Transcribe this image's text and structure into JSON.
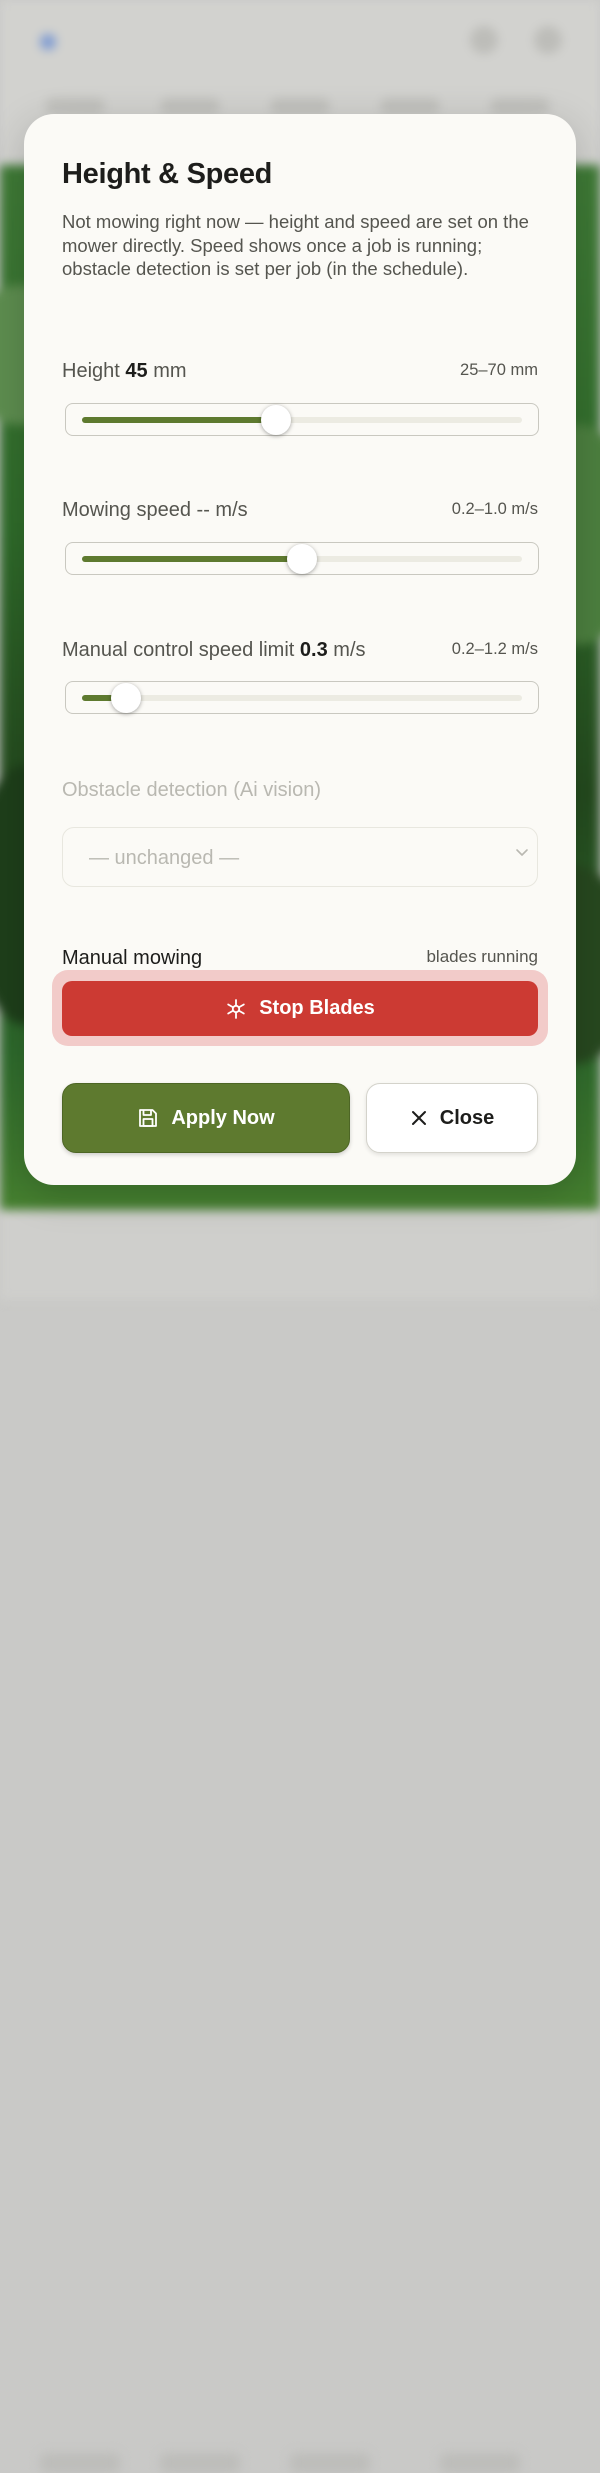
{
  "dialog": {
    "title": "Height & Speed",
    "description": "Not mowing right now — height and speed are set on the mower directly. Speed shows once a job is running; obstacle detection is set per job (in the schedule)."
  },
  "height": {
    "label": "Height",
    "value": "45",
    "unit": "mm",
    "range": "25–70 mm",
    "fraction": 0.44
  },
  "mowing_speed": {
    "label": "Mowing speed",
    "value": "--",
    "unit": "m/s",
    "range": "0.2–1.0 m/s",
    "fraction": 0.5
  },
  "manual_speed": {
    "label": "Manual control speed limit",
    "value": "0.3",
    "unit": "m/s",
    "range": "0.2–1.2 m/s",
    "fraction": 0.1
  },
  "obstacle": {
    "label": "Obstacle detection (Ai vision)",
    "selected": "— unchanged —"
  },
  "manual_mowing": {
    "label": "Manual mowing",
    "status": "blades running",
    "stop_label": "Stop Blades"
  },
  "footer": {
    "apply_label": "Apply Now",
    "close_label": "Close"
  },
  "colors": {
    "accent": "#5e7a2f",
    "danger": "#cc3a33",
    "surface": "#fbfaf6"
  },
  "icons": {
    "stop": "asterisk-icon",
    "apply": "save-icon",
    "close": "close-icon",
    "select": "chevron-down-icon"
  }
}
